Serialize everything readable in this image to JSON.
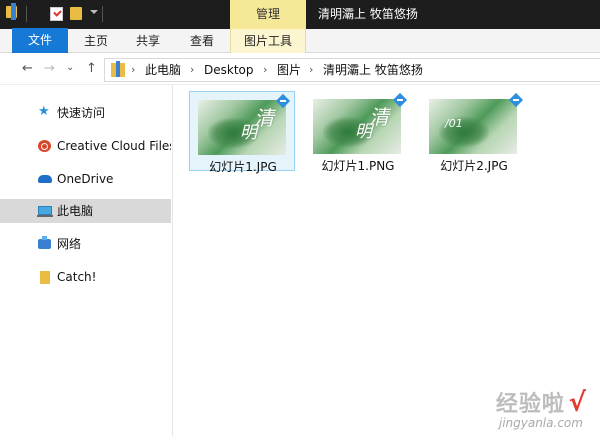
{
  "titlebar": {
    "context_tab": "管理",
    "window_title": "清明灞上 牧笛悠扬"
  },
  "ribbon": {
    "tabs": [
      "文件",
      "主页",
      "共享",
      "查看",
      "图片工具"
    ]
  },
  "nav": {
    "back": "←",
    "forward": "→",
    "recent": "⌄",
    "up": "↑"
  },
  "address": {
    "crumbs": [
      "此电脑",
      "Desktop",
      "图片",
      "清明灞上 牧笛悠扬"
    ],
    "sep": "›"
  },
  "sidebar": {
    "items": [
      {
        "label": "快速访问",
        "icon": "star-icon"
      },
      {
        "label": "Creative Cloud Files",
        "icon": "creative-cloud-icon"
      },
      {
        "label": "OneDrive",
        "icon": "cloud-icon"
      },
      {
        "label": "此电脑",
        "icon": "computer-icon",
        "selected": true
      },
      {
        "label": "网络",
        "icon": "network-icon"
      },
      {
        "label": "Catch!",
        "icon": "folder-icon"
      }
    ]
  },
  "files": [
    {
      "name": "幻灯片1.JPG",
      "selected": true,
      "glyph": "清",
      "glyph2": "明",
      "num": ""
    },
    {
      "name": "幻灯片1.PNG",
      "selected": false,
      "glyph": "清",
      "glyph2": "明",
      "num": ""
    },
    {
      "name": "幻灯片2.JPG",
      "selected": false,
      "glyph": "",
      "glyph2": "",
      "num": "/01"
    }
  ],
  "watermark": {
    "text": "经验啦",
    "check": "√",
    "url": "jingyanla.com"
  },
  "colors": {
    "accent": "#1779d6",
    "context_tab": "#f5e998",
    "selection": "#e5f3fb"
  }
}
